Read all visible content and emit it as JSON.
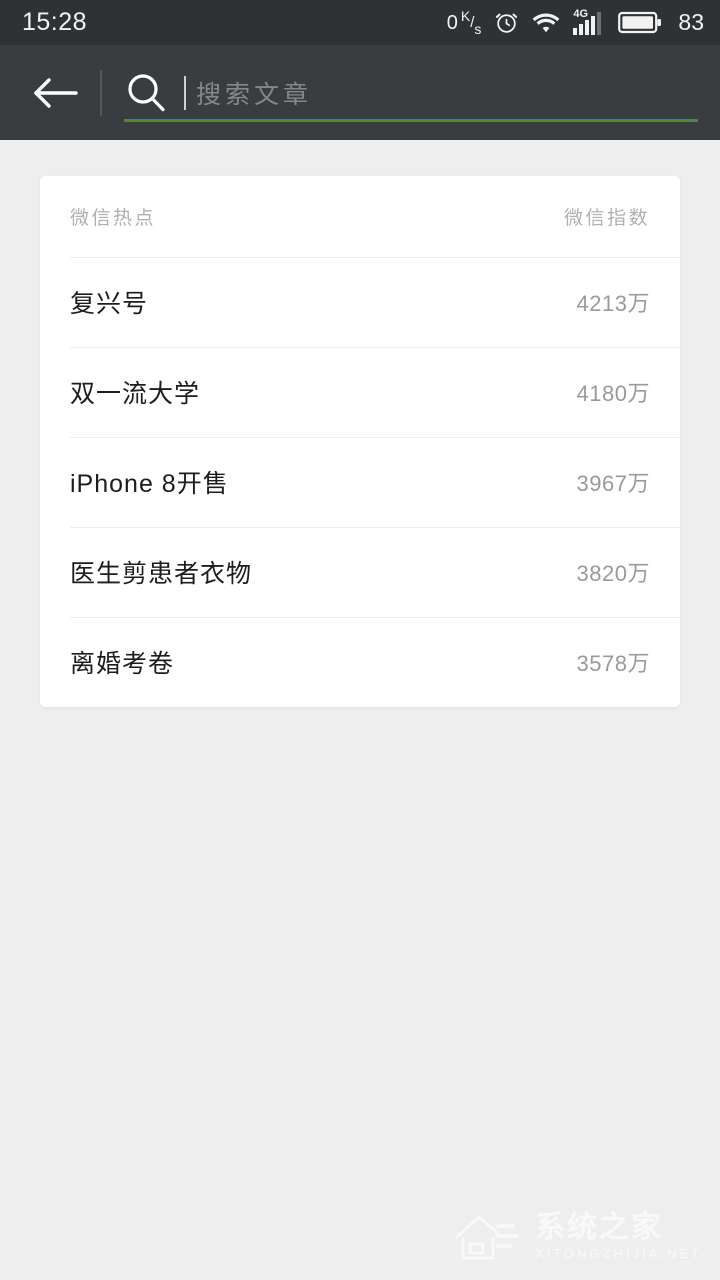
{
  "status_bar": {
    "time": "15:28",
    "net_speed_value": "0",
    "net_speed_unit_top": "K",
    "net_speed_unit_bottom": "s",
    "alarm_icon": "alarm-clock-icon",
    "wifi_icon": "wifi-icon",
    "network_type": "4G",
    "signal_icon": "signal-bars-icon",
    "battery_icon": "battery-icon",
    "battery_percent": "83"
  },
  "search_header": {
    "back_icon": "back-arrow-icon",
    "search_icon": "search-icon",
    "input_value": "",
    "placeholder": "搜索文章",
    "accent_color": "#4b8b35",
    "bar_color": "#3a3d40"
  },
  "card": {
    "header": {
      "left_label": "微信热点",
      "right_label": "微信指数"
    },
    "rows": [
      {
        "title": "复兴号",
        "value": "4213万"
      },
      {
        "title": "双一流大学",
        "value": "4180万"
      },
      {
        "title": "iPhone 8开售",
        "value": "3967万"
      },
      {
        "title": "医生剪患者衣物",
        "value": "3820万"
      },
      {
        "title": "离婚考卷",
        "value": "3578万"
      }
    ]
  },
  "watermark": {
    "logo_icon": "house-logo-icon",
    "main_text": "系统之家",
    "sub_text": "XITONGZHIJIA.NET"
  },
  "colors": {
    "page_background": "#eeeeee",
    "card_background": "#ffffff",
    "status_bar_background": "#2f3235",
    "accent_green": "#4b8b35",
    "title_text": "#1d1d1d",
    "muted_text": "#9a9a9a"
  }
}
